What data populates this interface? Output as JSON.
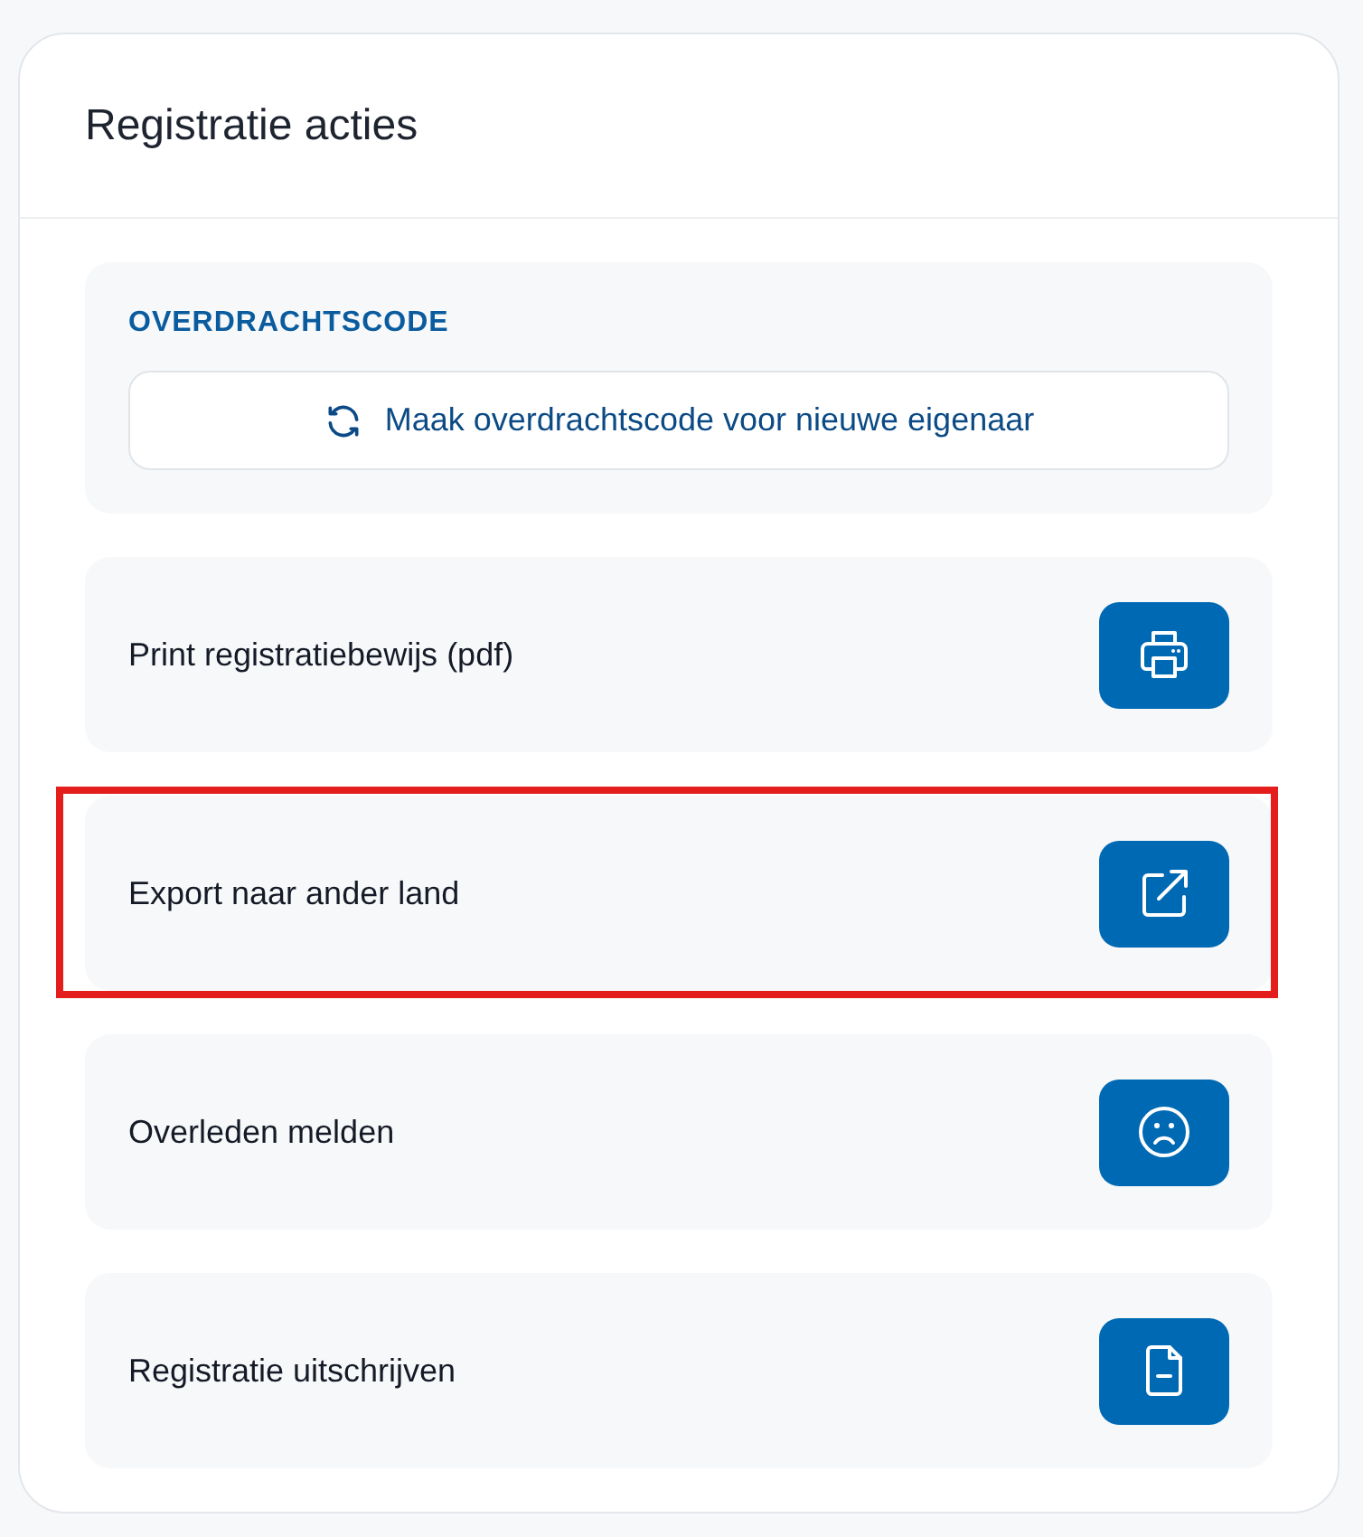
{
  "card": {
    "title": "Registratie acties"
  },
  "transfer_code": {
    "label": "OVERDRACHTSCODE",
    "button": "Maak overdrachtscode voor nieuwe eigenaar"
  },
  "actions": [
    {
      "label": "Print registratiebewijs (pdf)",
      "kind": "print",
      "highlighted": false
    },
    {
      "label": "Export naar ander land",
      "kind": "export",
      "highlighted": true
    },
    {
      "label": "Overleden melden",
      "kind": "deceased",
      "highlighted": false
    },
    {
      "label": "Registratie uitschrijven",
      "kind": "deregister",
      "highlighted": false
    }
  ]
}
